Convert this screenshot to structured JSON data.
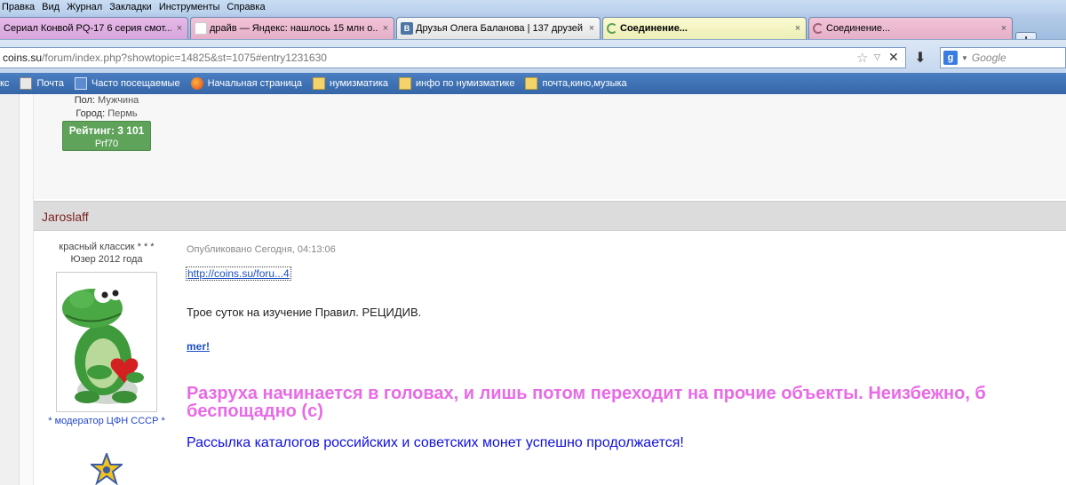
{
  "browser": {
    "menu": [
      "Правка",
      "Вид",
      "Журнал",
      "Закладки",
      "Инструменты",
      "Справка"
    ],
    "tabs": [
      {
        "label": "Сериал Конвой PQ-17 6 серия смот...",
        "close": "×"
      },
      {
        "label": "драйв — Яндекс: нашлось 15 млн о...",
        "close": "×",
        "favicon": "Я"
      },
      {
        "label": "Друзья Олега Баланова | 137 друзей",
        "close": "×",
        "favicon": "B"
      },
      {
        "label": "Соединение...",
        "close": "×"
      },
      {
        "label": "Соединение...",
        "close": "×"
      }
    ],
    "new_tab": "+",
    "url_host": "coins.su",
    "url_path": "/forum/index.php?showtopic=14825&st=1075#entry1231630",
    "search_placeholder": "Google",
    "search_engine_icon": "g",
    "bookmarks": [
      {
        "label": "кс",
        "icon": "none"
      },
      {
        "label": "Почта",
        "icon": "mail-icon"
      },
      {
        "label": "Часто посещаемые",
        "icon": "frequent-icon"
      },
      {
        "label": "Начальная страница",
        "icon": "firefox-icon"
      },
      {
        "label": "нумизматика",
        "icon": "folder-icon"
      },
      {
        "label": "инфо по нумизматике",
        "icon": "folder-icon"
      },
      {
        "label": "почта,кино,музыка",
        "icon": "folder-icon"
      }
    ]
  },
  "prev_post": {
    "gender_label": "Пол:",
    "gender_value": "Мужчина",
    "city_label": "Город:",
    "city_value": "Пермь",
    "rating": "Рейтинг: 3 101",
    "rating_sub": "Prf70"
  },
  "post": {
    "author": "Jaroslaff",
    "rank": "красный классик * * *",
    "joined": "Юзер 2012 года",
    "moderator": "* модератор ЦФН СССР *",
    "date": "Опубликовано Сегодня, 04:13:06",
    "link": "http://coins.su/foru...4",
    "text": "Трое суток на изучение Правил. РЕЦИДИВ.",
    "signature_link": "mer!",
    "signature_big": "Разруха начинается в головах, и лишь потом переходит на прочие объекты. Неизбежно, б беспощадно (с)",
    "signature_blue": "Рассылка каталогов российских и советских монет успешно продолжается!"
  },
  "colors": {
    "author_name": "#7a1f1f",
    "rating_bg": "#5fa35b",
    "signature_pink": "#e86ae6",
    "signature_blue": "#1010e0",
    "link": "#1b4fc4"
  }
}
